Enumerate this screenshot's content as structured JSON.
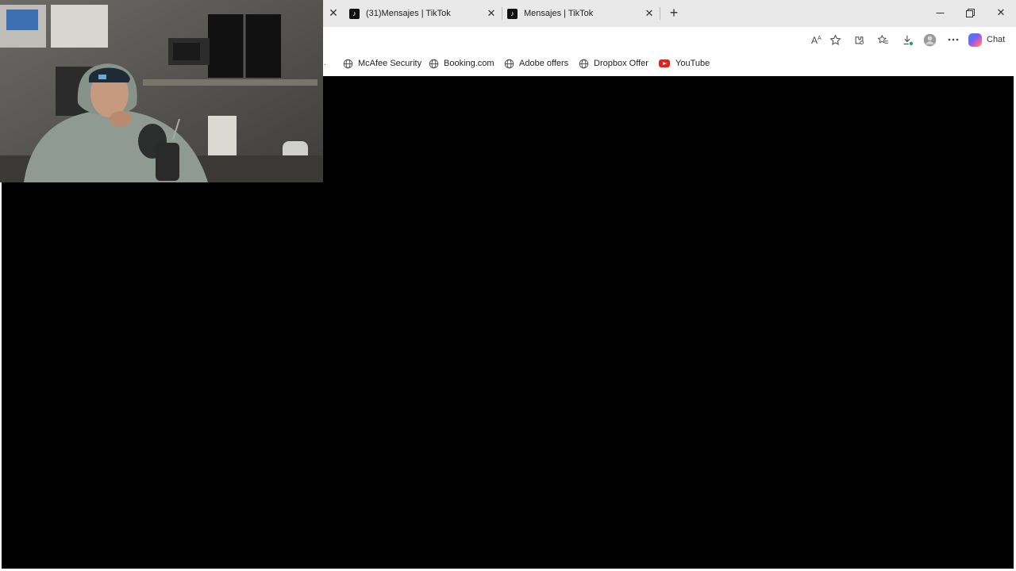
{
  "tabs": [
    {
      "label": "(31)Mensajes | TikTok",
      "favicon": "tiktok-icon"
    },
    {
      "label": "Mensajes | TikTok",
      "favicon": "tiktok-icon"
    }
  ],
  "toolbar": {
    "address_value": "",
    "chat_label": "Chat"
  },
  "favorites": [
    {
      "label": "McAfee Security",
      "icon": "globe-icon"
    },
    {
      "label": "Booking.com",
      "icon": "globe-icon"
    },
    {
      "label": "Adobe offers",
      "icon": "globe-icon"
    },
    {
      "label": "Dropbox Offer",
      "icon": "globe-icon"
    },
    {
      "label": "YouTube",
      "icon": "youtube-icon"
    }
  ],
  "colors": {
    "tabbar_bg": "#e9e9e9",
    "content_bg": "#000000",
    "youtube_red": "#e62117"
  }
}
